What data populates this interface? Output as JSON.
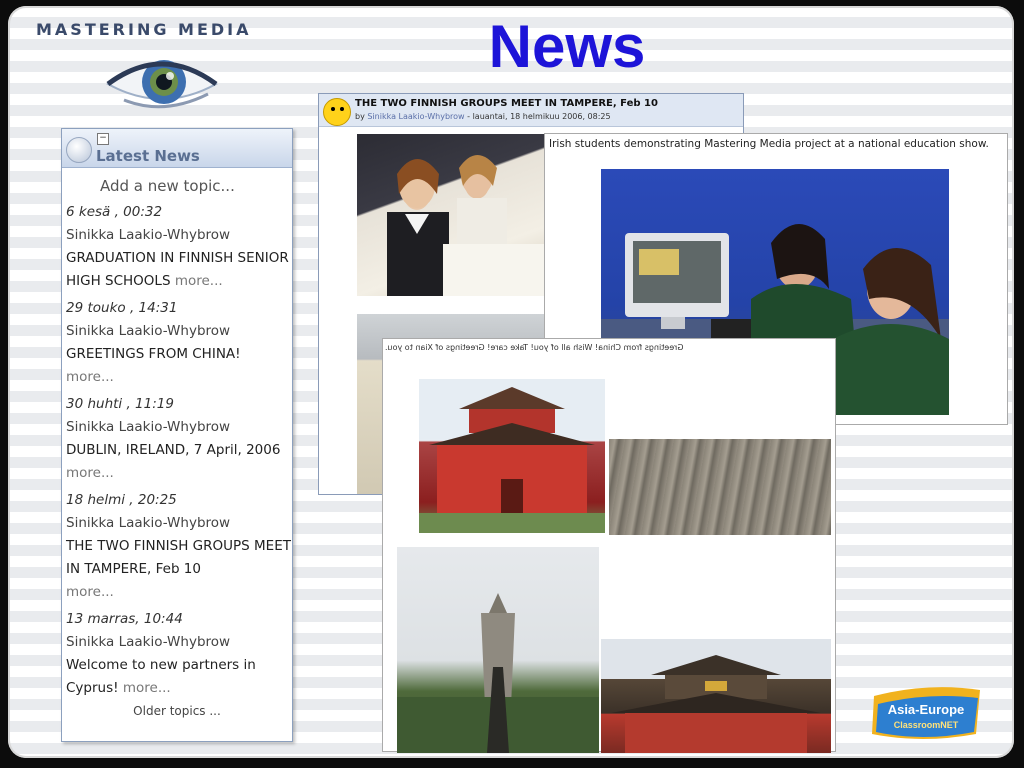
{
  "header": {
    "brand": "MASTERING MEDIA",
    "title": "News"
  },
  "latest_news": {
    "title": "Latest News",
    "collapse_symbol": "−",
    "add_topic": "Add a new topic...",
    "items": [
      {
        "date": "6 kesä , 00:32",
        "author": "Sinikka Laakio-Whybrow",
        "text": "GRADUATION IN FINNISH SENIOR HIGH SCHOOLS",
        "more": "more..."
      },
      {
        "date": "29 touko , 14:31",
        "author": "Sinikka Laakio-Whybrow",
        "text": "GREETINGS FROM CHINA!",
        "more": "more..."
      },
      {
        "date": "30 huhti , 11:19",
        "author": "Sinikka Laakio-Whybrow",
        "text": "DUBLIN, IRELAND, 7 April, 2006",
        "more": "more..."
      },
      {
        "date": "18 helmi , 20:25",
        "author": "Sinikka Laakio-Whybrow",
        "text": "THE TWO FINNISH GROUPS MEET IN TAMPERE, Feb 10",
        "more": "more..."
      },
      {
        "date": "13 marras, 10:44",
        "author": "Sinikka Laakio-Whybrow",
        "text": "Welcome to new partners in Cyprus!",
        "more": "more..."
      }
    ],
    "older_topics": "Older topics ..."
  },
  "forum_post": {
    "title": "THE TWO FINNISH GROUPS MEET IN TAMPERE, Feb 10",
    "by_label": "by",
    "author": "Sinikka Laakio-Whybrow",
    "date_suffix": " - lauantai, 18 helmikuu 2006, 08:25"
  },
  "irish_photo": {
    "caption": "Irish students demonstrating Mastering Media project at a national education show."
  },
  "china_photos": {
    "caption": "Greetings from China! Wish all of you! Take care! Greetings of Xian to you."
  },
  "logo": {
    "line1": "Asia-Europe",
    "line2": "ClassroomNET"
  }
}
